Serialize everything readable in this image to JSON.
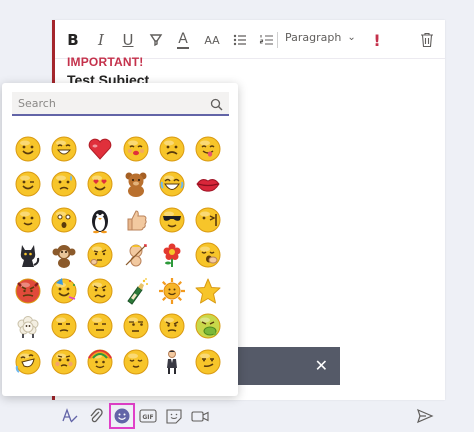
{
  "toolbar": {
    "paragraph_label": "Paragraph",
    "bold_glyph": "B",
    "italic_glyph": "I",
    "underline_glyph": "U",
    "font_color_glyph": "A",
    "font_size_glyph": "AA",
    "important_glyph": "!"
  },
  "message": {
    "important_label": "IMPORTANT!",
    "subject": "Test Subject"
  },
  "emoji_picker": {
    "search_placeholder": "Search",
    "emojis": [
      [
        "smile",
        "grin",
        "heart",
        "kiss",
        "sad",
        "tongue"
      ],
      [
        "wink",
        "sweat",
        "in-love",
        "bear",
        "laugh",
        "lips"
      ],
      [
        "smile-2",
        "surprised",
        "penguin",
        "thumbs-up",
        "cool",
        "mmm"
      ],
      [
        "cat",
        "monkey",
        "thinking",
        "cupid",
        "flower",
        "yawn"
      ],
      [
        "devil",
        "party",
        "worried",
        "champagne",
        "sun",
        "star"
      ],
      [
        "sheep",
        "unamused",
        "neutral",
        "side-eye",
        "disappointed",
        "puke"
      ],
      [
        "rofl",
        "shy",
        "rainbow-hair",
        "relieved",
        "person",
        "smirk"
      ]
    ]
  },
  "colors": {
    "accent": "#6264a7",
    "important": "#c4314b",
    "highlight": "#e040c8",
    "snack_bar": "#555a68"
  },
  "icons": {
    "bottom": [
      "format-icon",
      "attach-icon",
      "emoji-icon",
      "gif-icon",
      "sticker-icon",
      "meet-now-icon",
      "send-icon"
    ]
  }
}
